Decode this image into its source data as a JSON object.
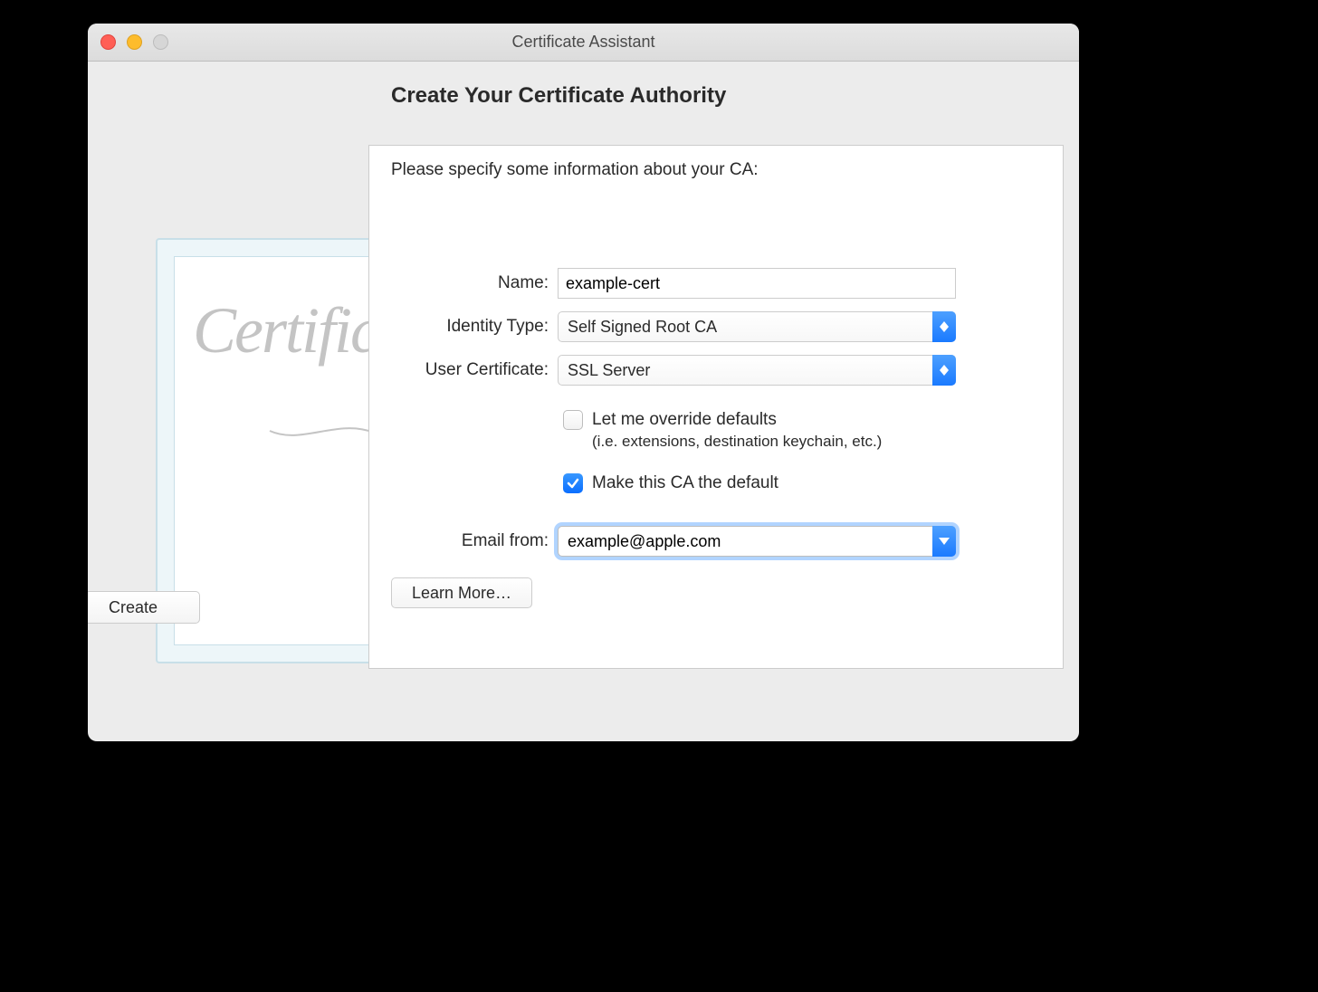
{
  "window": {
    "title": "Certificate Assistant"
  },
  "heading": "Create Your Certificate Authority",
  "description": "Please specify some information about your CA:",
  "fields": {
    "name": {
      "label": "Name:",
      "value": "example-cert"
    },
    "identity_type": {
      "label": "Identity Type:",
      "value": "Self Signed Root CA"
    },
    "user_certificate": {
      "label": "User Certificate:",
      "value": "SSL Server"
    },
    "email_from": {
      "label": "Email from:",
      "value": "example@apple.com"
    }
  },
  "checkboxes": {
    "override": {
      "label": "Let me override defaults",
      "subtext": "(i.e. extensions, destination keychain, etc.)",
      "checked": false
    },
    "make_default": {
      "label": "Make this CA the default",
      "checked": true
    }
  },
  "buttons": {
    "learn_more": "Learn More…",
    "create": "Create"
  }
}
